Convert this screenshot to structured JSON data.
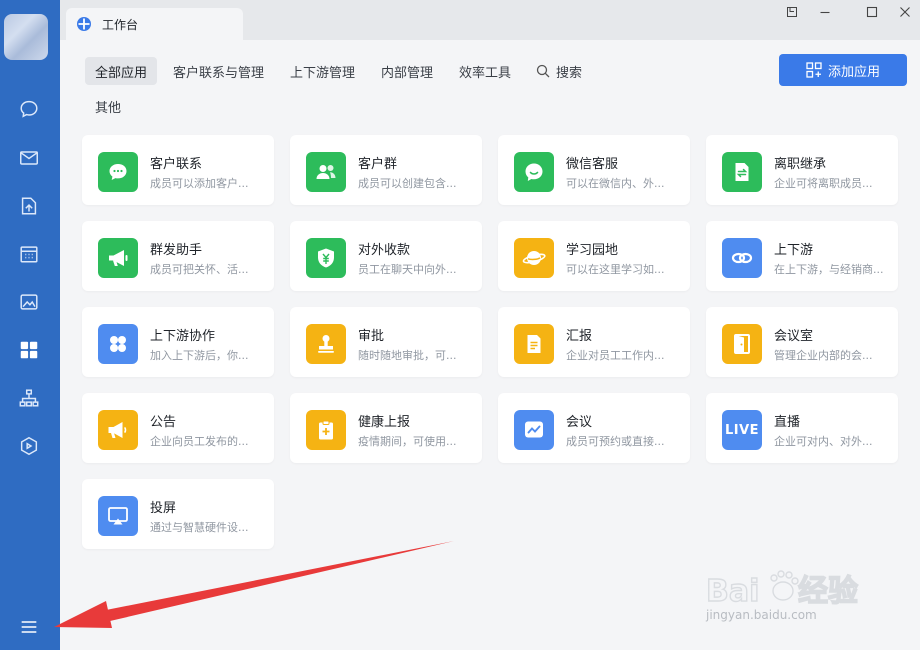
{
  "window": {
    "tab_title": "工作台"
  },
  "categories": [
    {
      "label": "全部应用",
      "active": true
    },
    {
      "label": "客户联系与管理"
    },
    {
      "label": "上下游管理"
    },
    {
      "label": "内部管理"
    },
    {
      "label": "效率工具"
    },
    {
      "label": "搜索"
    },
    {
      "label": "其他"
    }
  ],
  "add_button": {
    "label": "添加应用"
  },
  "apps": [
    {
      "name": "客户联系",
      "desc": "成员可以添加客户...",
      "icon": "chat-bubble-icon",
      "color": "#2dbc5b"
    },
    {
      "name": "客户群",
      "desc": "成员可以创建包含...",
      "icon": "group-icon",
      "color": "#2dbc5b"
    },
    {
      "name": "微信客服",
      "desc": "可以在微信内、外...",
      "icon": "smile-bubble-icon",
      "color": "#2dbc5b"
    },
    {
      "name": "离职继承",
      "desc": "企业可将离职成员...",
      "icon": "transfer-doc-icon",
      "color": "#2dbc5b"
    },
    {
      "name": "群发助手",
      "desc": "成员可把关怀、活...",
      "icon": "megaphone-icon",
      "color": "#2dbc5b"
    },
    {
      "name": "对外收款",
      "desc": "员工在聊天中向外...",
      "icon": "yuan-shield-icon",
      "color": "#2dbc5b"
    },
    {
      "name": "学习园地",
      "desc": "可以在这里学习如...",
      "icon": "planet-icon",
      "color": "#f5b313"
    },
    {
      "name": "上下游",
      "desc": "在上下游，与经销商...",
      "icon": "link-icon",
      "color": "#4f8cf0"
    },
    {
      "name": "上下游协作",
      "desc": "加入上下游后，你...",
      "icon": "clover-icon",
      "color": "#4f8cf0"
    },
    {
      "name": "审批",
      "desc": "随时随地审批，可...",
      "icon": "stamp-icon",
      "color": "#f5b313"
    },
    {
      "name": "汇报",
      "desc": "企业对员工工作内...",
      "icon": "report-icon",
      "color": "#f5b313"
    },
    {
      "name": "会议室",
      "desc": "管理企业内部的会...",
      "icon": "door-icon",
      "color": "#f5b313"
    },
    {
      "name": "公告",
      "desc": "企业向员工发布的...",
      "icon": "announce-icon",
      "color": "#f5b313"
    },
    {
      "name": "健康上报",
      "desc": "疫情期间，可使用...",
      "icon": "clipboard-plus-icon",
      "color": "#f5b313"
    },
    {
      "name": "会议",
      "desc": "成员可预约或直接...",
      "icon": "meeting-icon",
      "color": "#4f8cf0"
    },
    {
      "name": "直播",
      "desc": "企业可对内、对外...",
      "icon": "live-icon",
      "color": "#4f8cf0",
      "badge": "LIVE"
    },
    {
      "name": "投屏",
      "desc": "通过与智慧硬件设...",
      "icon": "screencast-icon",
      "color": "#4f8cf0"
    }
  ],
  "watermark": {
    "text": "jingyan.baidu.com",
    "brand": "Baidu 经验"
  }
}
